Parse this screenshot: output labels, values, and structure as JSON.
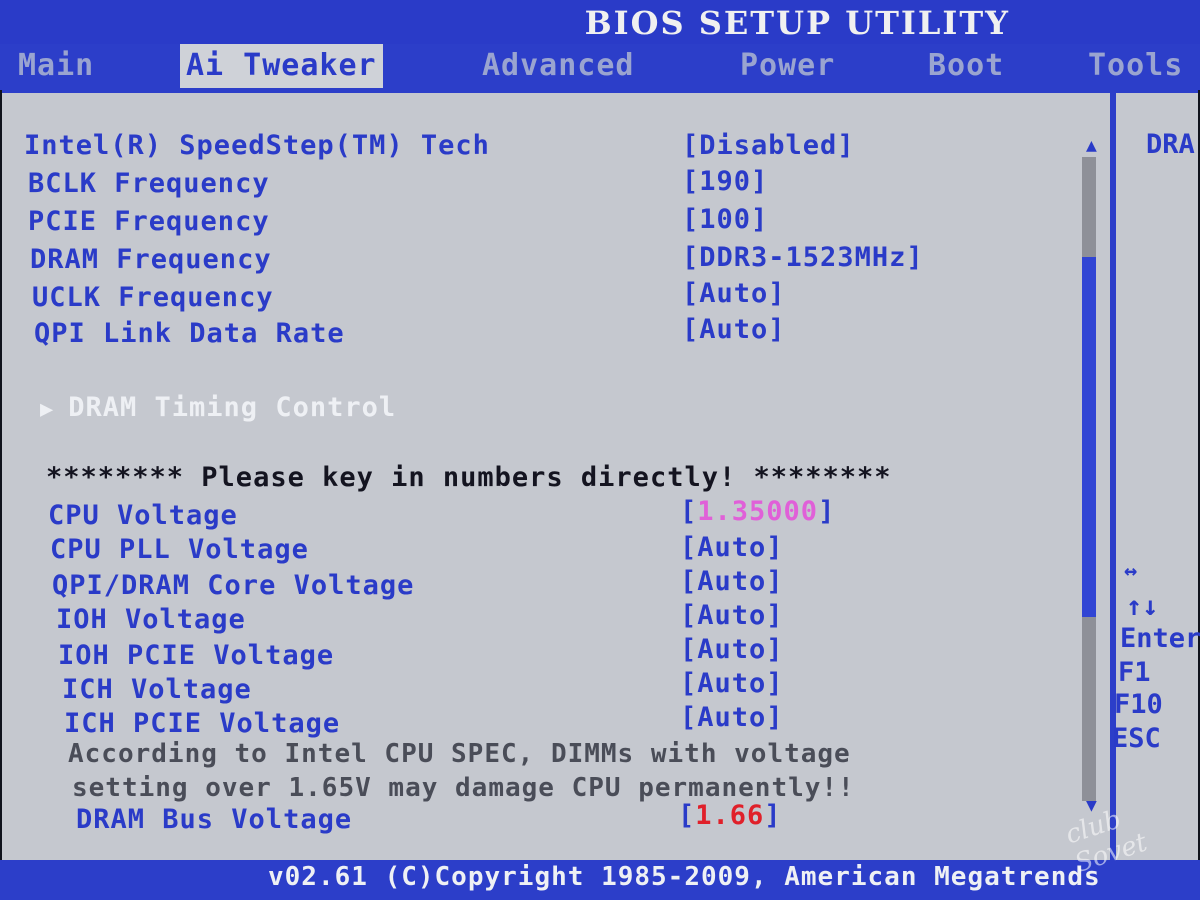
{
  "header": {
    "title": "BIOS SETUP UTILITY"
  },
  "menu": {
    "tabs": [
      {
        "label": "Main"
      },
      {
        "label": "Ai Tweaker"
      },
      {
        "label": "Advanced"
      },
      {
        "label": "Power"
      },
      {
        "label": "Boot"
      },
      {
        "label": "Tools"
      }
    ],
    "active_tab": "Ai Tweaker"
  },
  "settings": [
    {
      "label": "Intel(R) SpeedStep(TM) Tech",
      "value": "Disabled"
    },
    {
      "label": "BCLK Frequency",
      "value": "190"
    },
    {
      "label": "PCIE Frequency",
      "value": "100"
    },
    {
      "label": "DRAM Frequency",
      "value": "DDR3-1523MHz"
    },
    {
      "label": "UCLK Frequency",
      "value": "Auto"
    },
    {
      "label": "QPI Link Data Rate",
      "value": "Auto"
    }
  ],
  "submenu": {
    "label": "DRAM Timing Control"
  },
  "notice": "******** Please key in numbers directly! ********",
  "voltages": [
    {
      "label": "CPU Voltage",
      "value": "1.35000"
    },
    {
      "label": "CPU PLL Voltage",
      "value": "Auto"
    },
    {
      "label": "QPI/DRAM Core Voltage",
      "value": "Auto"
    },
    {
      "label": "IOH Voltage",
      "value": "Auto"
    },
    {
      "label": "IOH PCIE Voltage",
      "value": "Auto"
    },
    {
      "label": "ICH Voltage",
      "value": "Auto"
    },
    {
      "label": "ICH PCIE Voltage",
      "value": "Auto"
    }
  ],
  "warning": {
    "line1": "According to Intel CPU SPEC, DIMMs with voltage",
    "line2": "setting over 1.65V may damage CPU permanently!!"
  },
  "dram_bus": {
    "label": "DRAM Bus Voltage",
    "value": "1.66"
  },
  "help_panel": {
    "title": "DRA",
    "keys": [
      "↔",
      "↑↓",
      "Enter",
      "F1",
      "F10",
      "ESC"
    ]
  },
  "footer": {
    "copyright": "v02.61 (C)Copyright 1985-2009, American Megatrends"
  },
  "watermark": "club Sovet",
  "colors": {
    "accent": "#2c3ec9",
    "panel": "#c5c8cf",
    "highlight": "#e060d8",
    "danger": "#e0202a"
  }
}
